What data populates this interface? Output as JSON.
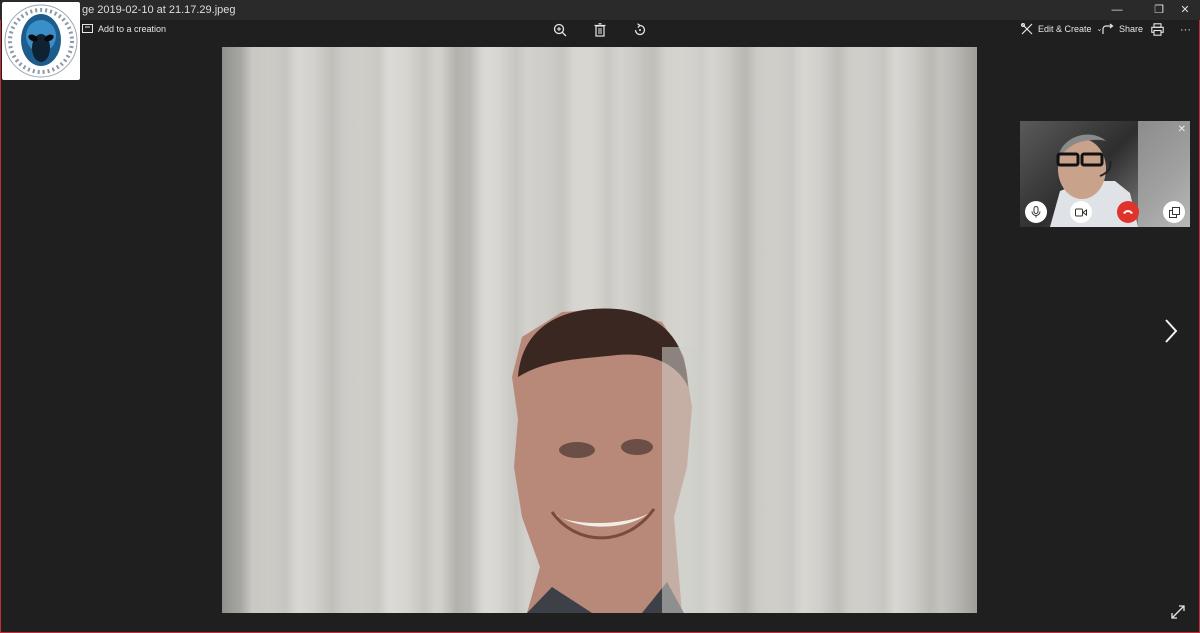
{
  "window": {
    "title": "ge 2019-02-10 at 21.17.29.jpeg",
    "minimize_glyph": "—",
    "restore_glyph": "❐",
    "close_glyph": "✕"
  },
  "toolbar": {
    "add_to_creation_label": "Add to a creation",
    "edit_create_label": "Edit & Create",
    "share_label": "Share",
    "more_glyph": "···"
  },
  "icons": {
    "logo": "alien-head-logo",
    "zoom": "zoom-in-icon",
    "delete": "trash-icon",
    "rotate": "rotate-icon",
    "next": "chevron-right-icon",
    "expand": "expand-icon",
    "mic": "microphone-icon",
    "video": "video-camera-icon",
    "hangup": "hang-up-icon",
    "popout": "pop-out-icon"
  },
  "colors": {
    "background": "#1f1f1f",
    "border": "#c0303a",
    "hangup": "#e0332c"
  },
  "call_overlay": {
    "close_glyph": "✕"
  }
}
